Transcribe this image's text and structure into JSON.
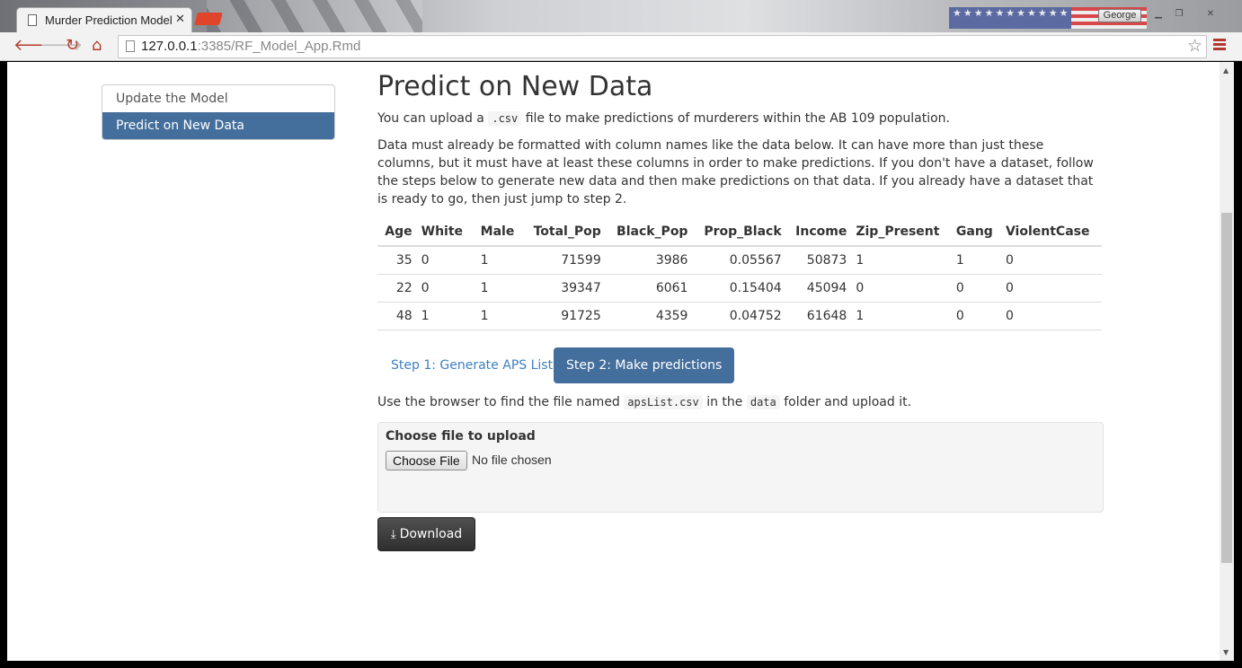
{
  "browser": {
    "tab_title": "Murder Prediction Model",
    "tab_close": "✕",
    "url_host": "127.0.0.1",
    "url_rest": ":3385/RF_Model_App.Rmd",
    "user_name": "George",
    "accent": "#b33a2d"
  },
  "sidebar": {
    "items": [
      {
        "label": "Update the Model"
      },
      {
        "label": "Predict on New Data"
      }
    ],
    "active_color": "#446e9b"
  },
  "main": {
    "title": "Predict on New Data",
    "intro_pre": "You can upload a ",
    "intro_code": ".csv",
    "intro_post": " file to make predictions of murderers within the AB 109 population.",
    "description": "Data must already be formatted with column names like the data below. It can have more than just these columns, but it must have at least these columns in order to make predictions. If you don't have a dataset, follow the steps below to generate new data and then make predictions on that data. If you already have a dataset that is ready to go, then just jump to step 2.",
    "table": {
      "headers": [
        "Age",
        "White",
        "Male",
        "Total_Pop",
        "Black_Pop",
        "Prop_Black",
        "Income",
        "Zip_Present",
        "Gang",
        "ViolentCase"
      ],
      "rows": [
        [
          "35",
          "0",
          "1",
          "71599",
          "3986",
          "0.05567",
          "50873",
          "1",
          "1",
          "0"
        ],
        [
          "22",
          "0",
          "1",
          "39347",
          "6061",
          "0.15404",
          "45094",
          "0",
          "0",
          "0"
        ],
        [
          "48",
          "1",
          "1",
          "91725",
          "4359",
          "0.04752",
          "61648",
          "1",
          "0",
          "0"
        ]
      ]
    },
    "tabs": [
      {
        "label": "Step 1: Generate APS List"
      },
      {
        "label": "Step 2: Make predictions"
      }
    ],
    "instruction_pre": "Use the browser to find the file named ",
    "instruction_code1": "apsList.csv",
    "instruction_mid": " in the ",
    "instruction_code2": "data",
    "instruction_post": " folder and upload it.",
    "upload": {
      "label": "Choose file to upload",
      "button": "Choose File",
      "status": "No file chosen"
    },
    "download_label": "Download"
  }
}
